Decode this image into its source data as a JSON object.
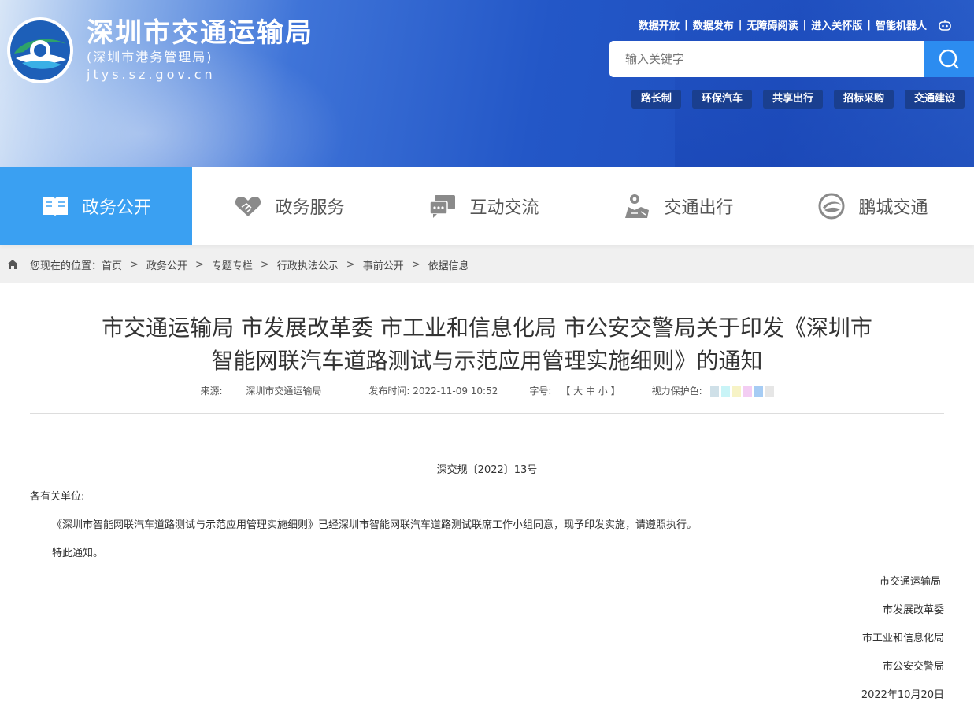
{
  "header": {
    "title": "深圳市交通运输局",
    "subtitle": "(深圳市港务管理局)",
    "domain": "jtys.sz.gov.cn",
    "logo_text": "深圳市交通运输局",
    "top_links": [
      "数据开放",
      "数据发布",
      "无障碍阅读",
      "进入关怀版",
      "智能机器人"
    ],
    "search_placeholder": "输入关键字",
    "quick_links": [
      "路长制",
      "环保汽车",
      "共享出行",
      "招标采购",
      "交通建设"
    ]
  },
  "nav": {
    "items": [
      {
        "label": "政务公开",
        "icon": "book-icon",
        "active": true
      },
      {
        "label": "政务服务",
        "icon": "handshake-icon",
        "active": false
      },
      {
        "label": "互动交流",
        "icon": "chat-icon",
        "active": false
      },
      {
        "label": "交通出行",
        "icon": "map-person-icon",
        "active": false
      },
      {
        "label": "鹏城交通",
        "icon": "swirl-logo-icon",
        "active": false
      }
    ]
  },
  "breadcrumb": {
    "prefix": "您现在的位置：",
    "items": [
      "首页",
      "政务公开",
      "专题专栏",
      "行政执法公示",
      "事前公开",
      "依据信息"
    ]
  },
  "article": {
    "title_line1": "市交通运输局 市发展改革委 市工业和信息化局 市公安交警局关于印发《深圳市",
    "title_line2": "智能网联汽车道路测试与示范应用管理实施细则》的通知",
    "source_label": "来源:",
    "source": "深圳市交通运输局",
    "date_label": "发布时间:",
    "date": "2022-11-09 10:52",
    "fontsize_label": "字号:",
    "fontsize_open": "【",
    "fontsize_large": "大",
    "fontsize_medium": "中",
    "fontsize_small": "小",
    "fontsize_close": "】",
    "eye_label": "视力保护色:",
    "eye_colors": [
      "#cfe0e8",
      "#c9f4f7",
      "#f7f3c6",
      "#f3cdf3",
      "#a6ccf4",
      "#e6e6e6"
    ],
    "doc_no": "深交规〔2022〕13号",
    "addressee": "各有关单位:",
    "body1": "《深圳市智能网联汽车道路测试与示范应用管理实施细则》已经深圳市智能网联汽车道路测试联席工作小组同意，现予印发实施，请遵照执行。",
    "body2": "特此通知。",
    "signatures": [
      "市交通运输局",
      "市发展改革委",
      "市工业和信息化局",
      "市公安交警局"
    ],
    "sign_date": "2022年10月20日"
  }
}
